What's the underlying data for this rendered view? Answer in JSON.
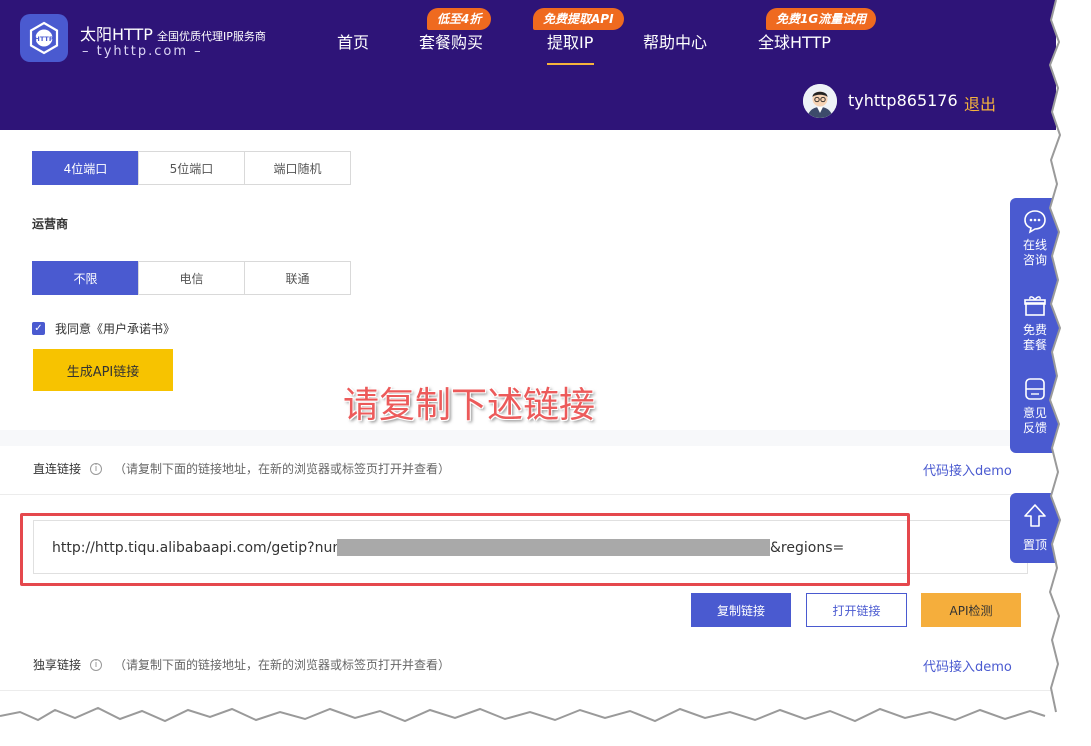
{
  "header": {
    "brand": "太阳HTTP",
    "slogan": "全国优质代理IP服务商",
    "domain": "– tyhttp.com –",
    "nav": [
      {
        "label": "首页"
      },
      {
        "label": "套餐购买",
        "badge": "低至4折"
      },
      {
        "label": "提取IP",
        "badge": "免费提取API",
        "active": true
      },
      {
        "label": "帮助中心"
      },
      {
        "label": "全球HTTP",
        "badge": "免费1G流量试用"
      }
    ],
    "username": "tyhttp865176",
    "logout": "退出"
  },
  "port_options": [
    "4位端口",
    "5位端口",
    "端口随机"
  ],
  "port_selected": "4位端口",
  "carrier": {
    "label": "运营商",
    "options": [
      "不限",
      "电信",
      "联通"
    ],
    "selected": "不限"
  },
  "agreement": {
    "checked": true,
    "text": "我同意《用户承诺书》"
  },
  "generate_button": "生成API链接",
  "annotation": "请复制下述链接",
  "direct_link": {
    "label": "直连链接",
    "hint": "（请复制下面的链接地址，在新的浏览器或标签页打开并查看）",
    "demo": "代码接入demo",
    "url_prefix": "http://http.tiqu.alibabaapi.com/getip?num",
    "url_suffix": "&regions="
  },
  "actions": {
    "copy": "复制链接",
    "open": "打开链接",
    "check": "API检测"
  },
  "exclusive_link": {
    "label": "独享链接",
    "hint": "（请复制下面的链接地址，在新的浏览器或标签页打开并查看）",
    "demo": "代码接入demo"
  },
  "side_panel": {
    "consult": "在线咨询",
    "free_package": "免费套餐",
    "feedback": "意见反馈",
    "top": "置顶"
  },
  "colors": {
    "header_bg": "#2e1478",
    "primary": "#4a5ad0",
    "accent_yellow": "#f7c300",
    "badge_orange": "#ef6a1f",
    "highlight_red": "#e5484d"
  }
}
